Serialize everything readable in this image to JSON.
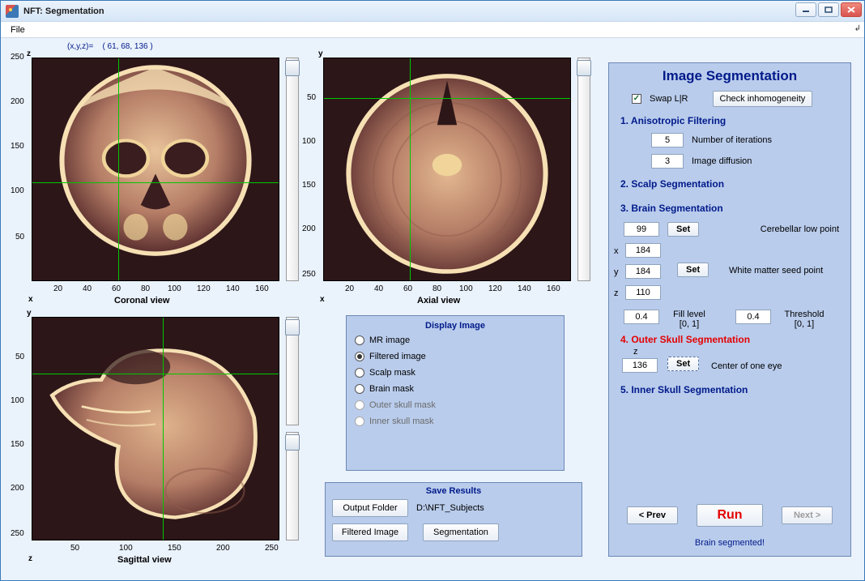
{
  "window": {
    "title": "NFT: Segmentation"
  },
  "menu": {
    "file": "File"
  },
  "coords_label": "(x,y,z)=",
  "coords_value": "( 61, 68, 136 )",
  "views": {
    "coronal": {
      "caption": "Coronal view",
      "axis_bottom": "x",
      "axis_top": "z",
      "yticks": [
        "250",
        "200",
        "150",
        "100",
        "50"
      ],
      "xticks": [
        "20",
        "40",
        "60",
        "80",
        "100",
        "120",
        "140",
        "160"
      ],
      "cross_x_pct": 35,
      "cross_y_pct": 56
    },
    "axial": {
      "caption": "Axial view",
      "axis_bottom": "x",
      "axis_top": "y",
      "yticks": [
        "50",
        "100",
        "150",
        "200",
        "250"
      ],
      "xticks": [
        "20",
        "40",
        "60",
        "80",
        "100",
        "120",
        "140",
        "160"
      ],
      "cross_x_pct": 35,
      "cross_y_pct": 18
    },
    "sagittal": {
      "caption": "Sagittal view",
      "axis_bottom": "z",
      "axis_top": "y",
      "yticks": [
        "50",
        "100",
        "150",
        "200",
        "250"
      ],
      "xticks": [
        "50",
        "100",
        "150",
        "200",
        "250"
      ],
      "cross_x_pct": 53,
      "cross_y_pct": 25
    }
  },
  "display_image": {
    "title": "Display Image",
    "options": {
      "mr": "MR image",
      "filtered": "Filtered image",
      "scalp": "Scalp mask",
      "brain": "Brain mask",
      "outer_skull": "Outer skull mask",
      "inner_skull": "Inner skull mask"
    },
    "selected": "filtered"
  },
  "save_results": {
    "title": "Save Results",
    "output_folder_btn": "Output Folder",
    "output_path": "D:\\NFT_Subjects",
    "filtered_btn": "Filtered Image",
    "segmentation_btn": "Segmentation"
  },
  "seg_panel": {
    "title": "Image Segmentation",
    "swap_lr": "Swap L|R",
    "check_inhom": "Check inhomogeneity",
    "aniso_title": "1. Anisotropic Filtering",
    "aniso_iter": "5",
    "aniso_iter_lab": "Number of iterations",
    "aniso_diff": "3",
    "aniso_diff_lab": "Image diffusion",
    "scalp_title": "2. Scalp Segmentation",
    "brain_title": "3. Brain Segmentation",
    "cereb_val": "99",
    "cereb_lab": "Cerebellar low point",
    "wm_x": "184",
    "wm_y": "184",
    "wm_z": "110",
    "wm_lab": "White matter seed point",
    "fill_val": "0.4",
    "fill_lab1": "Fill level",
    "fill_lab2": "[0, 1]",
    "thr_val": "0.4",
    "thr_lab1": "Threshold",
    "thr_lab2": "[0, 1]",
    "outer_title": "4. Outer Skull Segmentation",
    "eye_z": "136",
    "eye_lab": "Center of one eye",
    "inner_title": "5. Inner Skull Segmentation",
    "prev": "< Prev",
    "run": "Run",
    "next": "Next >",
    "set": "Set",
    "status": "Brain segmented!"
  }
}
